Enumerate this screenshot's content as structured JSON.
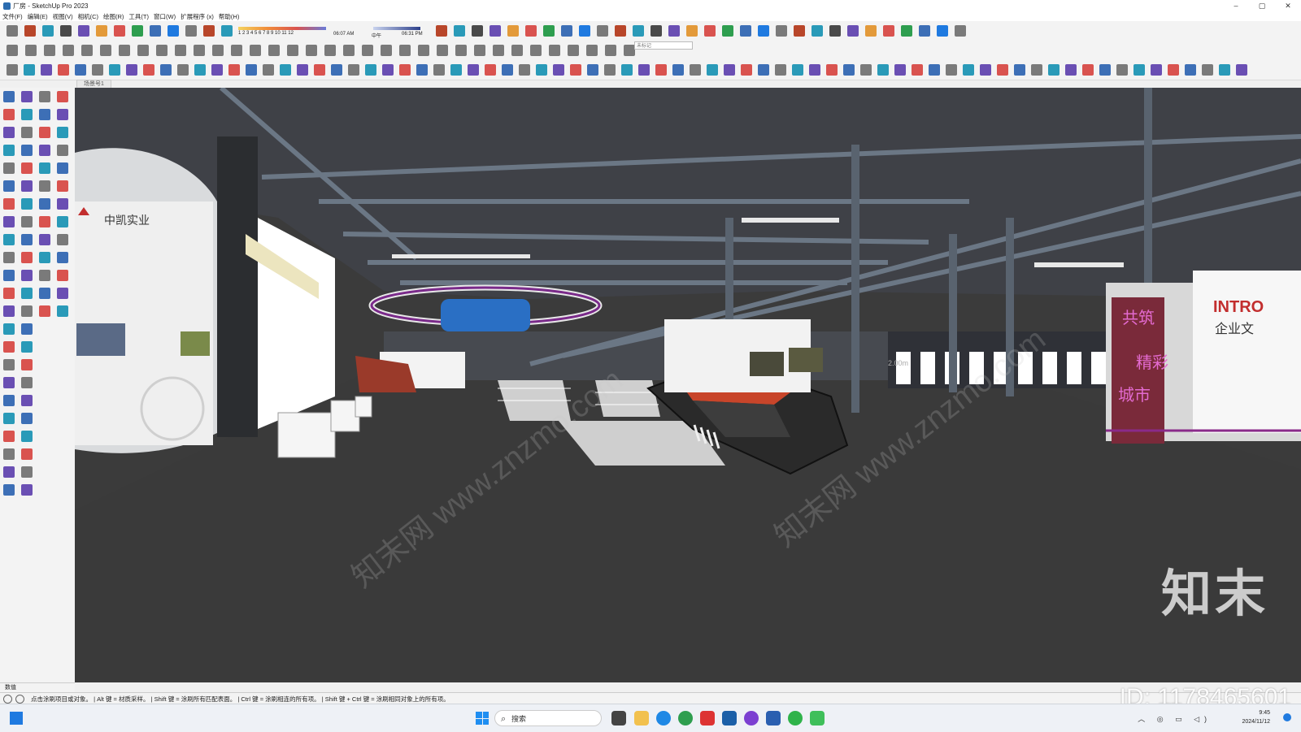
{
  "window": {
    "title": "厂房 - SketchUp Pro 2023",
    "controls": [
      "–",
      "▢",
      "✕"
    ]
  },
  "menu": [
    "文件(F)",
    "编辑(E)",
    "视图(V)",
    "相机(C)",
    "绘图(R)",
    "工具(T)",
    "窗口(W)",
    "扩展程序 (x)",
    "帮助(H)"
  ],
  "shadow_timeline": {
    "months": "1 2 3 4 5 6 7 8 9 10 11 12",
    "time_start": "06:07 AM",
    "noon": "中午",
    "time_end": "06:31 PM"
  },
  "tag_select": {
    "value": "未标记"
  },
  "scene_tab": {
    "label": "场景号1"
  },
  "viewport": {
    "sign_company": "中凯实业",
    "sign_intro": "INTRO",
    "sign_culture": "企业文",
    "sign_vertical": [
      "共筑",
      "精彩",
      "城市"
    ],
    "dimension_text": "2.00m",
    "watermark_logo": "知末",
    "watermark_repeat": "知末网 www.znzmo.com"
  },
  "measurements": {
    "label": "数值"
  },
  "status": {
    "hint": "点击涂刷项目或对象。 | Alt 键 = 材质采样。 | Shift 键 = 涂刷所有匹配表面。 | Ctrl 键 = 涂刷相连的所有项。 | Shift 键 + Ctrl 键 = 涂刷相同对象上的所有项。"
  },
  "id_watermark": "ID: 1178465601",
  "taskbar": {
    "search_placeholder": "搜索",
    "time": "9:45",
    "date": "2024/11/12"
  },
  "colors": {
    "viewport_floor": "#3a3a3a",
    "steel": "#5f6b78",
    "accent_red": "#c8452a",
    "purple": "#8a2a8a"
  }
}
